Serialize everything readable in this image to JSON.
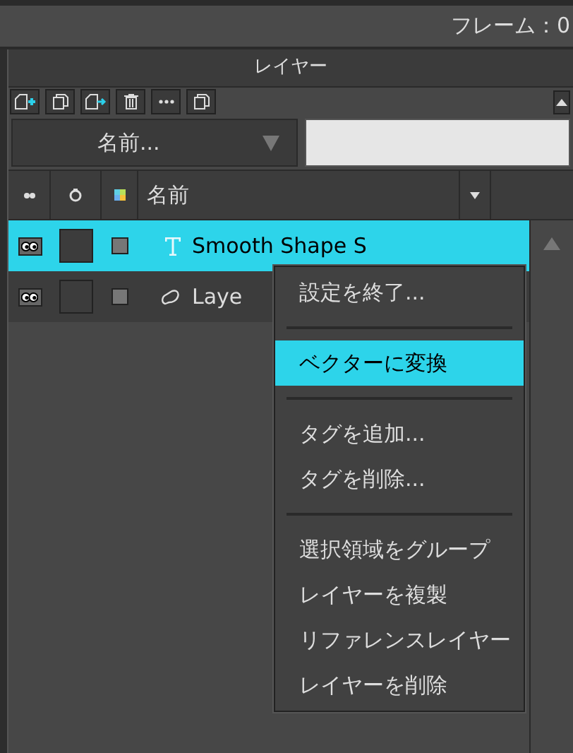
{
  "header": {
    "frame_label": "フレーム：0"
  },
  "panel": {
    "title": "レイヤー"
  },
  "toolbar": [
    {
      "kind": "new-layer"
    },
    {
      "kind": "copy"
    },
    {
      "kind": "move"
    },
    {
      "kind": "delete"
    },
    {
      "kind": "more"
    },
    {
      "kind": "copy"
    }
  ],
  "filter": {
    "dropdown": "名前..."
  },
  "columns": {
    "name": "名前"
  },
  "layers": [
    {
      "name": "Smooth Shape S",
      "kind": "text",
      "visible": true,
      "selected": true
    },
    {
      "name": "Laye",
      "kind": "vector",
      "visible": true,
      "selected": false
    }
  ],
  "context_menu": [
    {
      "kind": "item",
      "label": "設定を終了...",
      "selected": false
    },
    {
      "kind": "separator"
    },
    {
      "kind": "item",
      "label": "ベクターに変換",
      "selected": true
    },
    {
      "kind": "separator"
    },
    {
      "kind": "item",
      "label": "タグを追加...",
      "selected": false
    },
    {
      "kind": "item",
      "label": "タグを削除...",
      "selected": false
    },
    {
      "kind": "separator"
    },
    {
      "kind": "item",
      "label": "選択領域をグループ",
      "selected": false
    },
    {
      "kind": "item",
      "label": "レイヤーを複製",
      "selected": false
    },
    {
      "kind": "item",
      "label": "リファレンスレイヤー",
      "selected": false
    },
    {
      "kind": "item",
      "label": "レイヤーを削除",
      "selected": false
    }
  ]
}
